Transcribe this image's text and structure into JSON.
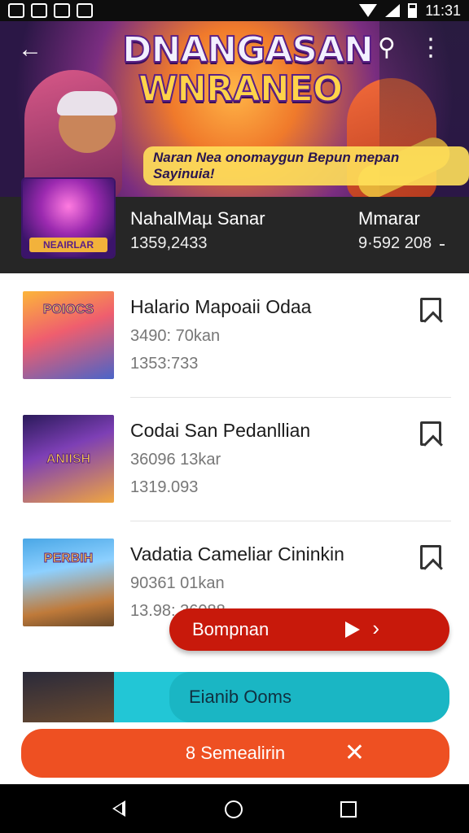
{
  "status_bar": {
    "time": "11:31"
  },
  "hero": {
    "title_line1": "DNANGASAN",
    "title_line2": "WNRANEO",
    "subtitle": "Naran Nea onomaygun Bepun mepan Sayinuia!"
  },
  "featured": {
    "thumb_label": "NEAIRLAR",
    "name": "NahalMaµ Sanar",
    "number": "1359,2433",
    "name2": "Mmarar",
    "number2": "9·592 208"
  },
  "items": [
    {
      "title": "Halario Mapoaii Odaa",
      "sub": "3490: 70kan",
      "sub2": "1353:733",
      "thumb_label": "POIOCS"
    },
    {
      "title": "Codai San Pedanllian",
      "sub": "36096 13kar",
      "sub2": "1319.093",
      "thumb_label": "ANIISH"
    },
    {
      "title": "Vadatia Cameliar Cininkin",
      "sub": "90361 01kan",
      "sub2": "13.98: 36088",
      "thumb_label": "PERBIH"
    }
  ],
  "buttons": {
    "red": "Bompnan",
    "cyan": "Eianib Ooms",
    "orange": "8 Semealirin"
  },
  "colors": {
    "red": "#c8190b",
    "cyan": "#1ab6c4",
    "orange": "#ee5022"
  }
}
